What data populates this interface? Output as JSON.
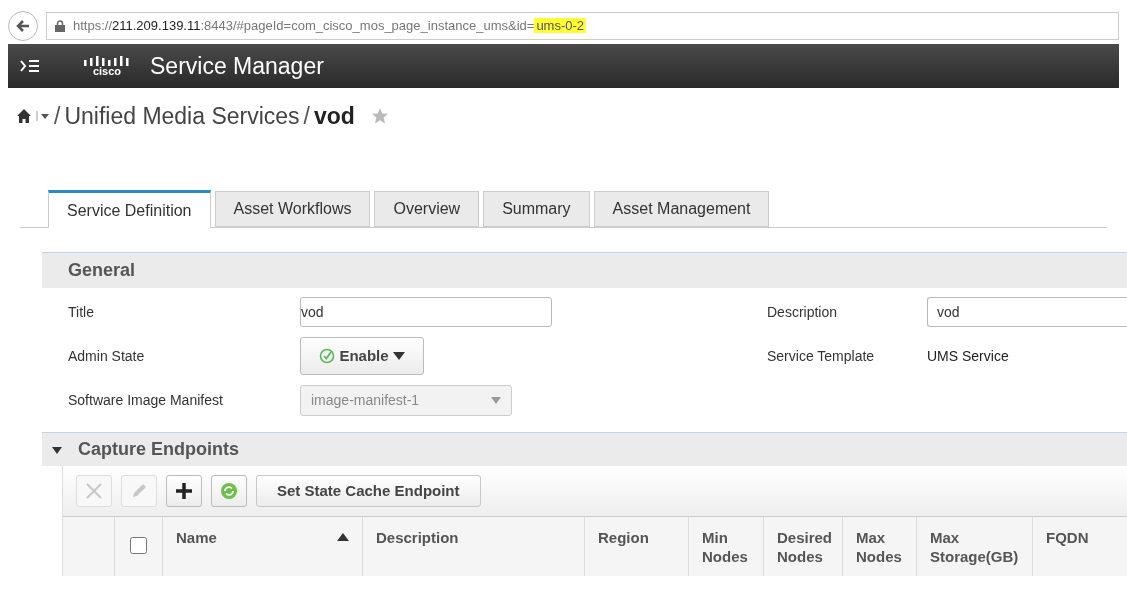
{
  "browser": {
    "url_parts": [
      {
        "kind": "plain",
        "text": "https://"
      },
      {
        "kind": "host",
        "text": "211.209.139.11"
      },
      {
        "kind": "plain",
        "text": ":8443/#pageId=com_cisco_mos_page_instance_ums&id="
      },
      {
        "kind": "highlight",
        "text": "ums-0-2"
      }
    ]
  },
  "header": {
    "title": "Service Manager",
    "logo_text": "cisco"
  },
  "breadcrumb": [
    {
      "separator": "/",
      "text": "Unified Media Services",
      "current": false
    },
    {
      "separator": "/",
      "text": "vod",
      "current": true
    }
  ],
  "tabs": [
    {
      "label": "Service Definition",
      "selected": true
    },
    {
      "label": "Asset Workflows",
      "selected": false
    },
    {
      "label": "Overview",
      "selected": false
    },
    {
      "label": "Summary",
      "selected": false
    },
    {
      "label": "Asset Management",
      "selected": false
    }
  ],
  "general": {
    "heading": "General",
    "title_label": "Title",
    "title_value": "vod",
    "admin_state_label": "Admin State",
    "admin_state_value": "Enable",
    "manifest_label": "Software Image Manifest",
    "manifest_value": "image-manifest-1",
    "manifest_disabled": true,
    "description_label": "Description",
    "description_value": "vod",
    "template_label": "Service Template",
    "template_value": "UMS Service"
  },
  "capture_endpoints": {
    "heading": "Capture Endpoints",
    "expanded": true,
    "toolbar": [
      {
        "kind": "delete",
        "disabled": true
      },
      {
        "kind": "edit",
        "disabled": true
      },
      {
        "kind": "add",
        "disabled": false
      },
      {
        "kind": "refresh",
        "disabled": false
      },
      {
        "kind": "text",
        "label": "Set State Cache Endpoint",
        "disabled": false
      }
    ],
    "select_all_checked": false,
    "columns": [
      {
        "label": "Name",
        "sorted": true
      },
      {
        "label": "Description",
        "sorted": false
      },
      {
        "label": "Region",
        "sorted": false
      },
      {
        "label": "Min Nodes",
        "sorted": false
      },
      {
        "label": "Desired Nodes",
        "sorted": false
      },
      {
        "label": "Max Nodes",
        "sorted": false
      },
      {
        "label": "Max Storage(GB)",
        "sorted": false
      },
      {
        "label": "FQDN",
        "sorted": false
      }
    ]
  }
}
